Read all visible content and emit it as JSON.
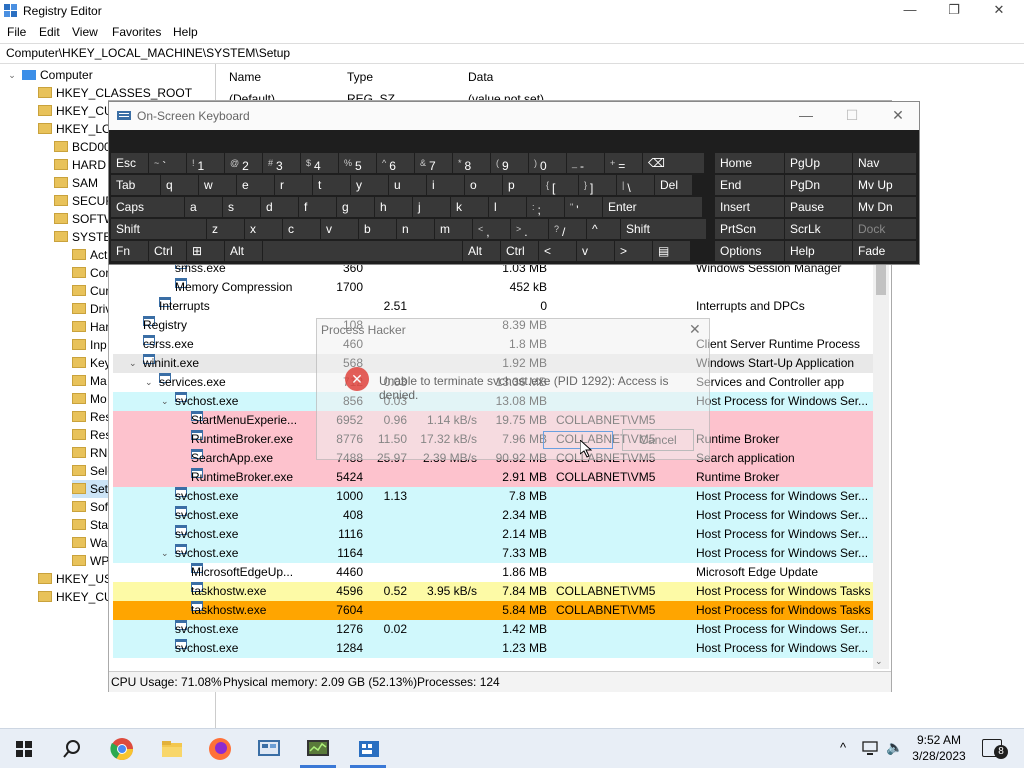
{
  "registry": {
    "title": "Registry Editor",
    "menu": [
      "File",
      "Edit",
      "View",
      "Favorites",
      "Help"
    ],
    "address": "Computer\\HKEY_LOCAL_MACHINE\\SYSTEM\\Setup",
    "tree": {
      "root": "Computer",
      "hives": [
        "HKEY_CLASSES_ROOT",
        "HKEY_CU",
        "HKEY_LO",
        "HKEY_USI",
        "HKEY_CU"
      ],
      "system_children": [
        "BCD00",
        "HARD",
        "SAM",
        "SECUR",
        "SOFTW",
        "SYSTE"
      ],
      "system_keys": [
        "Act",
        "Cor",
        "Cur",
        "Driv",
        "Har",
        "Inp",
        "Key",
        "Ma",
        "Mo",
        "Res",
        "Res",
        "RN",
        "Sele",
        "Setu",
        "Sof",
        "Stat",
        "Wa",
        "WP"
      ]
    },
    "list_headers": [
      "Name",
      "Type",
      "Data"
    ],
    "first_row": {
      "name": "(Default)",
      "type": "REG_SZ",
      "data": "(value not set)"
    }
  },
  "osk": {
    "title": "On-Screen Keyboard",
    "rows": [
      [
        {
          "l": "Esc"
        },
        {
          "s": "~",
          "l": "`"
        },
        {
          "s": "!",
          "l": "1"
        },
        {
          "s": "@",
          "l": "2"
        },
        {
          "s": "#",
          "l": "3"
        },
        {
          "s": "$",
          "l": "4"
        },
        {
          "s": "%",
          "l": "5"
        },
        {
          "s": "^",
          "l": "6"
        },
        {
          "s": "&",
          "l": "7"
        },
        {
          "s": "*",
          "l": "8"
        },
        {
          "s": "(",
          "l": "9"
        },
        {
          "s": ")",
          "l": "0"
        },
        {
          "s": "_",
          "l": "-"
        },
        {
          "s": "+",
          "l": "="
        },
        {
          "l": "⌫"
        }
      ],
      [
        {
          "l": "Tab"
        },
        {
          "l": "q"
        },
        {
          "l": "w"
        },
        {
          "l": "e"
        },
        {
          "l": "r"
        },
        {
          "l": "t"
        },
        {
          "l": "y"
        },
        {
          "l": "u"
        },
        {
          "l": "i"
        },
        {
          "l": "o"
        },
        {
          "l": "p"
        },
        {
          "s": "{",
          "l": "["
        },
        {
          "s": "}",
          "l": "]"
        },
        {
          "s": "|",
          "l": "\\"
        },
        {
          "l": "Del"
        }
      ],
      [
        {
          "l": "Caps"
        },
        {
          "l": "a"
        },
        {
          "l": "s"
        },
        {
          "l": "d"
        },
        {
          "l": "f"
        },
        {
          "l": "g"
        },
        {
          "l": "h"
        },
        {
          "l": "j"
        },
        {
          "l": "k"
        },
        {
          "l": "l"
        },
        {
          "s": ":",
          "l": ";"
        },
        {
          "s": "\"",
          "l": "'"
        },
        {
          "l": "Enter"
        }
      ],
      [
        {
          "l": "Shift"
        },
        {
          "l": "z"
        },
        {
          "l": "x"
        },
        {
          "l": "c"
        },
        {
          "l": "v"
        },
        {
          "l": "b"
        },
        {
          "l": "n"
        },
        {
          "l": "m"
        },
        {
          "s": "<",
          "l": ","
        },
        {
          "s": ">",
          "l": "."
        },
        {
          "s": "?",
          "l": "/"
        },
        {
          "l": "^"
        },
        {
          "l": "Shift"
        }
      ],
      [
        {
          "l": "Fn"
        },
        {
          "l": "Ctrl"
        },
        {
          "l": "⊞"
        },
        {
          "l": "Alt"
        },
        {
          "l": ""
        },
        {
          "l": "Alt"
        },
        {
          "l": "Ctrl"
        },
        {
          "l": "<"
        },
        {
          "l": "v"
        },
        {
          "l": ">"
        },
        {
          "l": "▤"
        }
      ]
    ],
    "nav": [
      [
        "Home",
        "PgUp",
        "Nav"
      ],
      [
        "End",
        "PgDn",
        "Mv Up"
      ],
      [
        "Insert",
        "Pause",
        "Mv Dn"
      ],
      [
        "PrtScn",
        "ScrLk",
        "Dock"
      ],
      [
        "Options",
        "Help",
        "Fade"
      ]
    ]
  },
  "processes": [
    {
      "name": "smss.exe",
      "pid": "360",
      "cpu": "",
      "io": "",
      "mem": "1.03 MB",
      "user": "",
      "desc": "Windows Session Manager",
      "bg": "#ffffff",
      "indent": 3
    },
    {
      "name": "Memory Compression",
      "pid": "1700",
      "cpu": "",
      "io": "",
      "mem": "452 kB",
      "user": "",
      "desc": "",
      "bg": "#ffffff",
      "indent": 3
    },
    {
      "name": "Interrupts",
      "pid": "",
      "cpu": "2.51",
      "io": "",
      "mem": "0",
      "user": "",
      "desc": "Interrupts and DPCs",
      "bg": "#ffffff",
      "indent": 2
    },
    {
      "name": "Registry",
      "pid": "108",
      "cpu": "",
      "io": "",
      "mem": "8.39 MB",
      "user": "",
      "desc": "",
      "bg": "#ffffff",
      "indent": 1
    },
    {
      "name": "csrss.exe",
      "pid": "460",
      "cpu": "",
      "io": "",
      "mem": "1.8 MB",
      "user": "",
      "desc": "Client Server Runtime Process",
      "bg": "#ffffff",
      "indent": 1
    },
    {
      "name": "wininit.exe",
      "pid": "568",
      "cpu": "",
      "io": "",
      "mem": "1.92 MB",
      "user": "",
      "desc": "Windows Start-Up Application",
      "bg": "#e8e8e8",
      "indent": 1,
      "tw": true
    },
    {
      "name": "services.exe",
      "pid": "712",
      "cpu": "0.03",
      "io": "",
      "mem": "13.36 MB",
      "user": "",
      "desc": "Services and Controller app",
      "bg": "#ffffff",
      "indent": 2,
      "tw": true
    },
    {
      "name": "svchost.exe",
      "pid": "856",
      "cpu": "0.03",
      "io": "",
      "mem": "13.08 MB",
      "user": "",
      "desc": "Host Process for Windows Ser...",
      "bg": "#d0f8fc",
      "indent": 3,
      "tw": true
    },
    {
      "name": "StartMenuExperie...",
      "pid": "6952",
      "cpu": "0.96",
      "io": "1.14 kB/s",
      "mem": "19.75 MB",
      "user": "COLLABNET\\VM5",
      "desc": "",
      "bg": "#fdc2cd",
      "indent": 4
    },
    {
      "name": "RuntimeBroker.exe",
      "pid": "8776",
      "cpu": "11.50",
      "io": "17.32 kB/s",
      "mem": "7.96 MB",
      "user": "COLLABNET\\VM5",
      "desc": "Runtime Broker",
      "bg": "#fdc2cd",
      "indent": 4
    },
    {
      "name": "SearchApp.exe",
      "pid": "7488",
      "cpu": "25.97",
      "io": "2.39 MB/s",
      "mem": "90.92 MB",
      "user": "COLLABNET\\VM5",
      "desc": "Search application",
      "bg": "#fdc2cd",
      "indent": 4
    },
    {
      "name": "RuntimeBroker.exe",
      "pid": "5424",
      "cpu": "",
      "io": "",
      "mem": "2.91 MB",
      "user": "COLLABNET\\VM5",
      "desc": "Runtime Broker",
      "bg": "#fdc2cd",
      "indent": 4
    },
    {
      "name": "svchost.exe",
      "pid": "1000",
      "cpu": "1.13",
      "io": "",
      "mem": "7.8 MB",
      "user": "",
      "desc": "Host Process for Windows Ser...",
      "bg": "#d0f8fc",
      "indent": 3
    },
    {
      "name": "svchost.exe",
      "pid": "408",
      "cpu": "",
      "io": "",
      "mem": "2.34 MB",
      "user": "",
      "desc": "Host Process for Windows Ser...",
      "bg": "#d0f8fc",
      "indent": 3
    },
    {
      "name": "svchost.exe",
      "pid": "1116",
      "cpu": "",
      "io": "",
      "mem": "2.14 MB",
      "user": "",
      "desc": "Host Process for Windows Ser...",
      "bg": "#d0f8fc",
      "indent": 3
    },
    {
      "name": "svchost.exe",
      "pid": "1164",
      "cpu": "",
      "io": "",
      "mem": "7.33 MB",
      "user": "",
      "desc": "Host Process for Windows Ser...",
      "bg": "#d0f8fc",
      "indent": 3,
      "tw": true
    },
    {
      "name": "MicrosoftEdgeUp...",
      "pid": "4460",
      "cpu": "",
      "io": "",
      "mem": "1.86 MB",
      "user": "",
      "desc": "Microsoft Edge Update",
      "bg": "#ffffff",
      "indent": 4
    },
    {
      "name": "taskhostw.exe",
      "pid": "4596",
      "cpu": "0.52",
      "io": "3.95 kB/s",
      "mem": "7.84 MB",
      "user": "COLLABNET\\VM5",
      "desc": "Host Process for Windows Tasks",
      "bg": "#fdfaa6",
      "indent": 4
    },
    {
      "name": "taskhostw.exe",
      "pid": "7604",
      "cpu": "",
      "io": "",
      "mem": "5.84 MB",
      "user": "COLLABNET\\VM5",
      "desc": "Host Process for Windows Tasks",
      "bg": "#ffa500",
      "indent": 4
    },
    {
      "name": "svchost.exe",
      "pid": "1276",
      "cpu": "0.02",
      "io": "",
      "mem": "1.42 MB",
      "user": "",
      "desc": "Host Process for Windows Ser...",
      "bg": "#d0f8fc",
      "indent": 3
    },
    {
      "name": "svchost.exe",
      "pid": "1284",
      "cpu": "",
      "io": "",
      "mem": "1.23 MB",
      "user": "",
      "desc": "Host Process for Windows Ser...",
      "bg": "#d0f8fc",
      "indent": 3
    }
  ],
  "status": {
    "cpu": "CPU Usage: 71.08%",
    "memory": "Physical memory: 2.09 GB (52.13%)",
    "processes": "Processes: 124"
  },
  "dialog": {
    "title": "Process Hacker",
    "message": "Unable to terminate svchost.exe (PID 1292): Access is denied.",
    "cancel": "Cancel"
  },
  "taskbar": {
    "time": "9:52 AM",
    "date": "3/28/2023",
    "notifications": "8"
  }
}
